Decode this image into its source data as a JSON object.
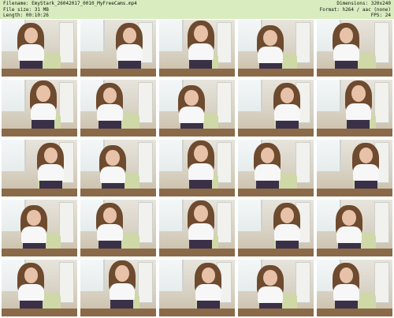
{
  "header": {
    "filename_label": "Filename:",
    "filename_value": "EmyStark_26042017_0010_MyFreeCams.mp4",
    "filesize_label": "File size:",
    "filesize_value": "31 MB",
    "length_label": "Length:",
    "length_value": "00:10:26",
    "dimensions_label": "Dimensions:",
    "dimensions_value": "320x240",
    "format_label": "Format:",
    "format_value": "h264 / aac (none)",
    "fps_label": "FPS:",
    "fps_value": "24"
  },
  "thumbnails": [
    {
      "pose": "pose-1"
    },
    {
      "pose": "pose-2"
    },
    {
      "pose": "pose-3"
    },
    {
      "pose": "pose-4"
    },
    {
      "pose": "pose-1"
    },
    {
      "pose": "pose-3"
    },
    {
      "pose": "pose-1"
    },
    {
      "pose": "pose-4"
    },
    {
      "pose": "pose-2"
    },
    {
      "pose": "pose-3"
    },
    {
      "pose": "pose-2"
    },
    {
      "pose": "pose-4"
    },
    {
      "pose": "pose-3"
    },
    {
      "pose": "pose-1"
    },
    {
      "pose": "pose-2"
    },
    {
      "pose": "pose-4"
    },
    {
      "pose": "pose-1"
    },
    {
      "pose": "pose-3"
    },
    {
      "pose": "pose-2"
    },
    {
      "pose": "pose-4"
    },
    {
      "pose": "pose-1"
    },
    {
      "pose": "pose-3"
    },
    {
      "pose": "pose-2"
    },
    {
      "pose": "pose-4"
    },
    {
      "pose": "pose-1"
    }
  ]
}
